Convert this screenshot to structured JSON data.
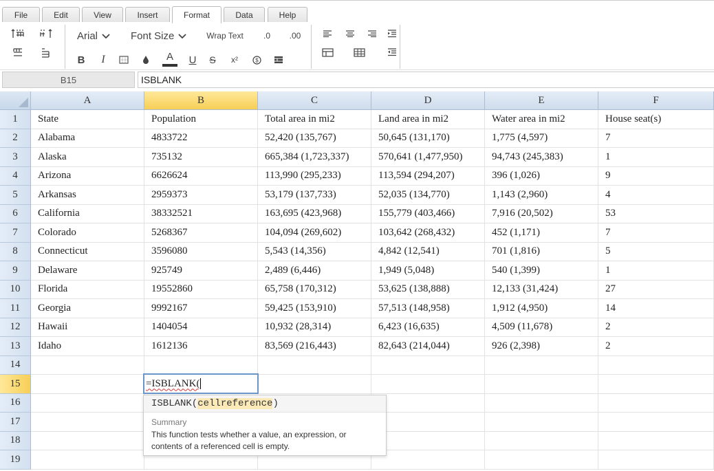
{
  "menu": {
    "tabs": [
      {
        "label": "File"
      },
      {
        "label": "Edit"
      },
      {
        "label": "View"
      },
      {
        "label": "Insert"
      },
      {
        "label": "Format"
      },
      {
        "label": "Data"
      },
      {
        "label": "Help"
      }
    ],
    "active": "Format"
  },
  "toolbar": {
    "font_family": "Arial",
    "font_size": "Font Size",
    "wrap_text": "Wrap Text",
    "decrease_decimal": ".0",
    "increase_decimal": ".00",
    "bold": "B",
    "italic": "I",
    "underline": "U",
    "strike": "S",
    "superscript": "x²",
    "font_color": "A",
    "colors": {
      "accent": "#f7cf55",
      "header": "#cfdcec",
      "selection_border": "#6a95c9"
    }
  },
  "formula_bar": {
    "cell_ref": "B15",
    "content": "ISBLANK"
  },
  "grid": {
    "columns": [
      "A",
      "B",
      "C",
      "D",
      "E",
      "F"
    ],
    "selected_column": "B",
    "selected_row": "15",
    "rows": [
      {
        "num": "1",
        "cells": [
          "State",
          "Population",
          "Total area in mi2",
          "Land area in mi2",
          "Water area in mi2",
          "House seat(s)"
        ]
      },
      {
        "num": "2",
        "cells": [
          "Alabama",
          "4833722",
          "52,420 (135,767)",
          "50,645 (131,170)",
          "1,775 (4,597)",
          "7"
        ]
      },
      {
        "num": "3",
        "cells": [
          "Alaska",
          "735132",
          "665,384 (1,723,337)",
          "570,641 (1,477,950)",
          "94,743 (245,383)",
          "1"
        ]
      },
      {
        "num": "4",
        "cells": [
          "Arizona",
          "6626624",
          "113,990 (295,233)",
          "113,594 (294,207)",
          "396 (1,026)",
          "9"
        ]
      },
      {
        "num": "5",
        "cells": [
          "Arkansas",
          "2959373",
          "53,179 (137,733)",
          "52,035 (134,770)",
          "1,143 (2,960)",
          "4"
        ]
      },
      {
        "num": "6",
        "cells": [
          "California",
          "38332521",
          "163,695 (423,968)",
          "155,779 (403,466)",
          "7,916 (20,502)",
          "53"
        ]
      },
      {
        "num": "7",
        "cells": [
          "Colorado",
          "5268367",
          "104,094 (269,602)",
          "103,642 (268,432)",
          "452 (1,171)",
          "7"
        ]
      },
      {
        "num": "8",
        "cells": [
          "Connecticut",
          "3596080",
          "5,543 (14,356)",
          "4,842 (12,541)",
          "701 (1,816)",
          "5"
        ]
      },
      {
        "num": "9",
        "cells": [
          "Delaware",
          "925749",
          "2,489 (6,446)",
          "1,949 (5,048)",
          "540 (1,399)",
          "1"
        ]
      },
      {
        "num": "10",
        "cells": [
          "Florida",
          "19552860",
          "65,758 (170,312)",
          "53,625 (138,888)",
          "12,133 (31,424)",
          "27"
        ]
      },
      {
        "num": "11",
        "cells": [
          "Georgia",
          "9992167",
          "59,425 (153,910)",
          "57,513 (148,958)",
          "1,912 (4,950)",
          "14"
        ]
      },
      {
        "num": "12",
        "cells": [
          "Hawaii",
          "1404054",
          "10,932 (28,314)",
          "6,423 (16,635)",
          "4,509 (11,678)",
          "2"
        ]
      },
      {
        "num": "13",
        "cells": [
          "Idaho",
          "1612136",
          "83,569 (216,443)",
          "82,643 (214,044)",
          "926 (2,398)",
          "2"
        ]
      },
      {
        "num": "14",
        "cells": [
          "",
          "",
          "",
          "",
          "",
          ""
        ]
      },
      {
        "num": "15",
        "cells": [
          "",
          "",
          "",
          "",
          "",
          ""
        ]
      },
      {
        "num": "16",
        "cells": [
          "",
          "",
          "",
          "",
          "",
          ""
        ]
      },
      {
        "num": "17",
        "cells": [
          "",
          "",
          "",
          "",
          "",
          ""
        ]
      },
      {
        "num": "18",
        "cells": [
          "",
          "",
          "",
          "",
          "",
          ""
        ]
      },
      {
        "num": "19",
        "cells": [
          "",
          "",
          "",
          "",
          "",
          ""
        ]
      }
    ]
  },
  "editor": {
    "value": "=ISBLANK("
  },
  "tooltip": {
    "func": "ISBLANK(",
    "arg": "cellreference",
    "close": ")",
    "summary_label": "Summary",
    "description": "This function tests whether a value, an expression, or contents of a referenced cell is empty."
  }
}
